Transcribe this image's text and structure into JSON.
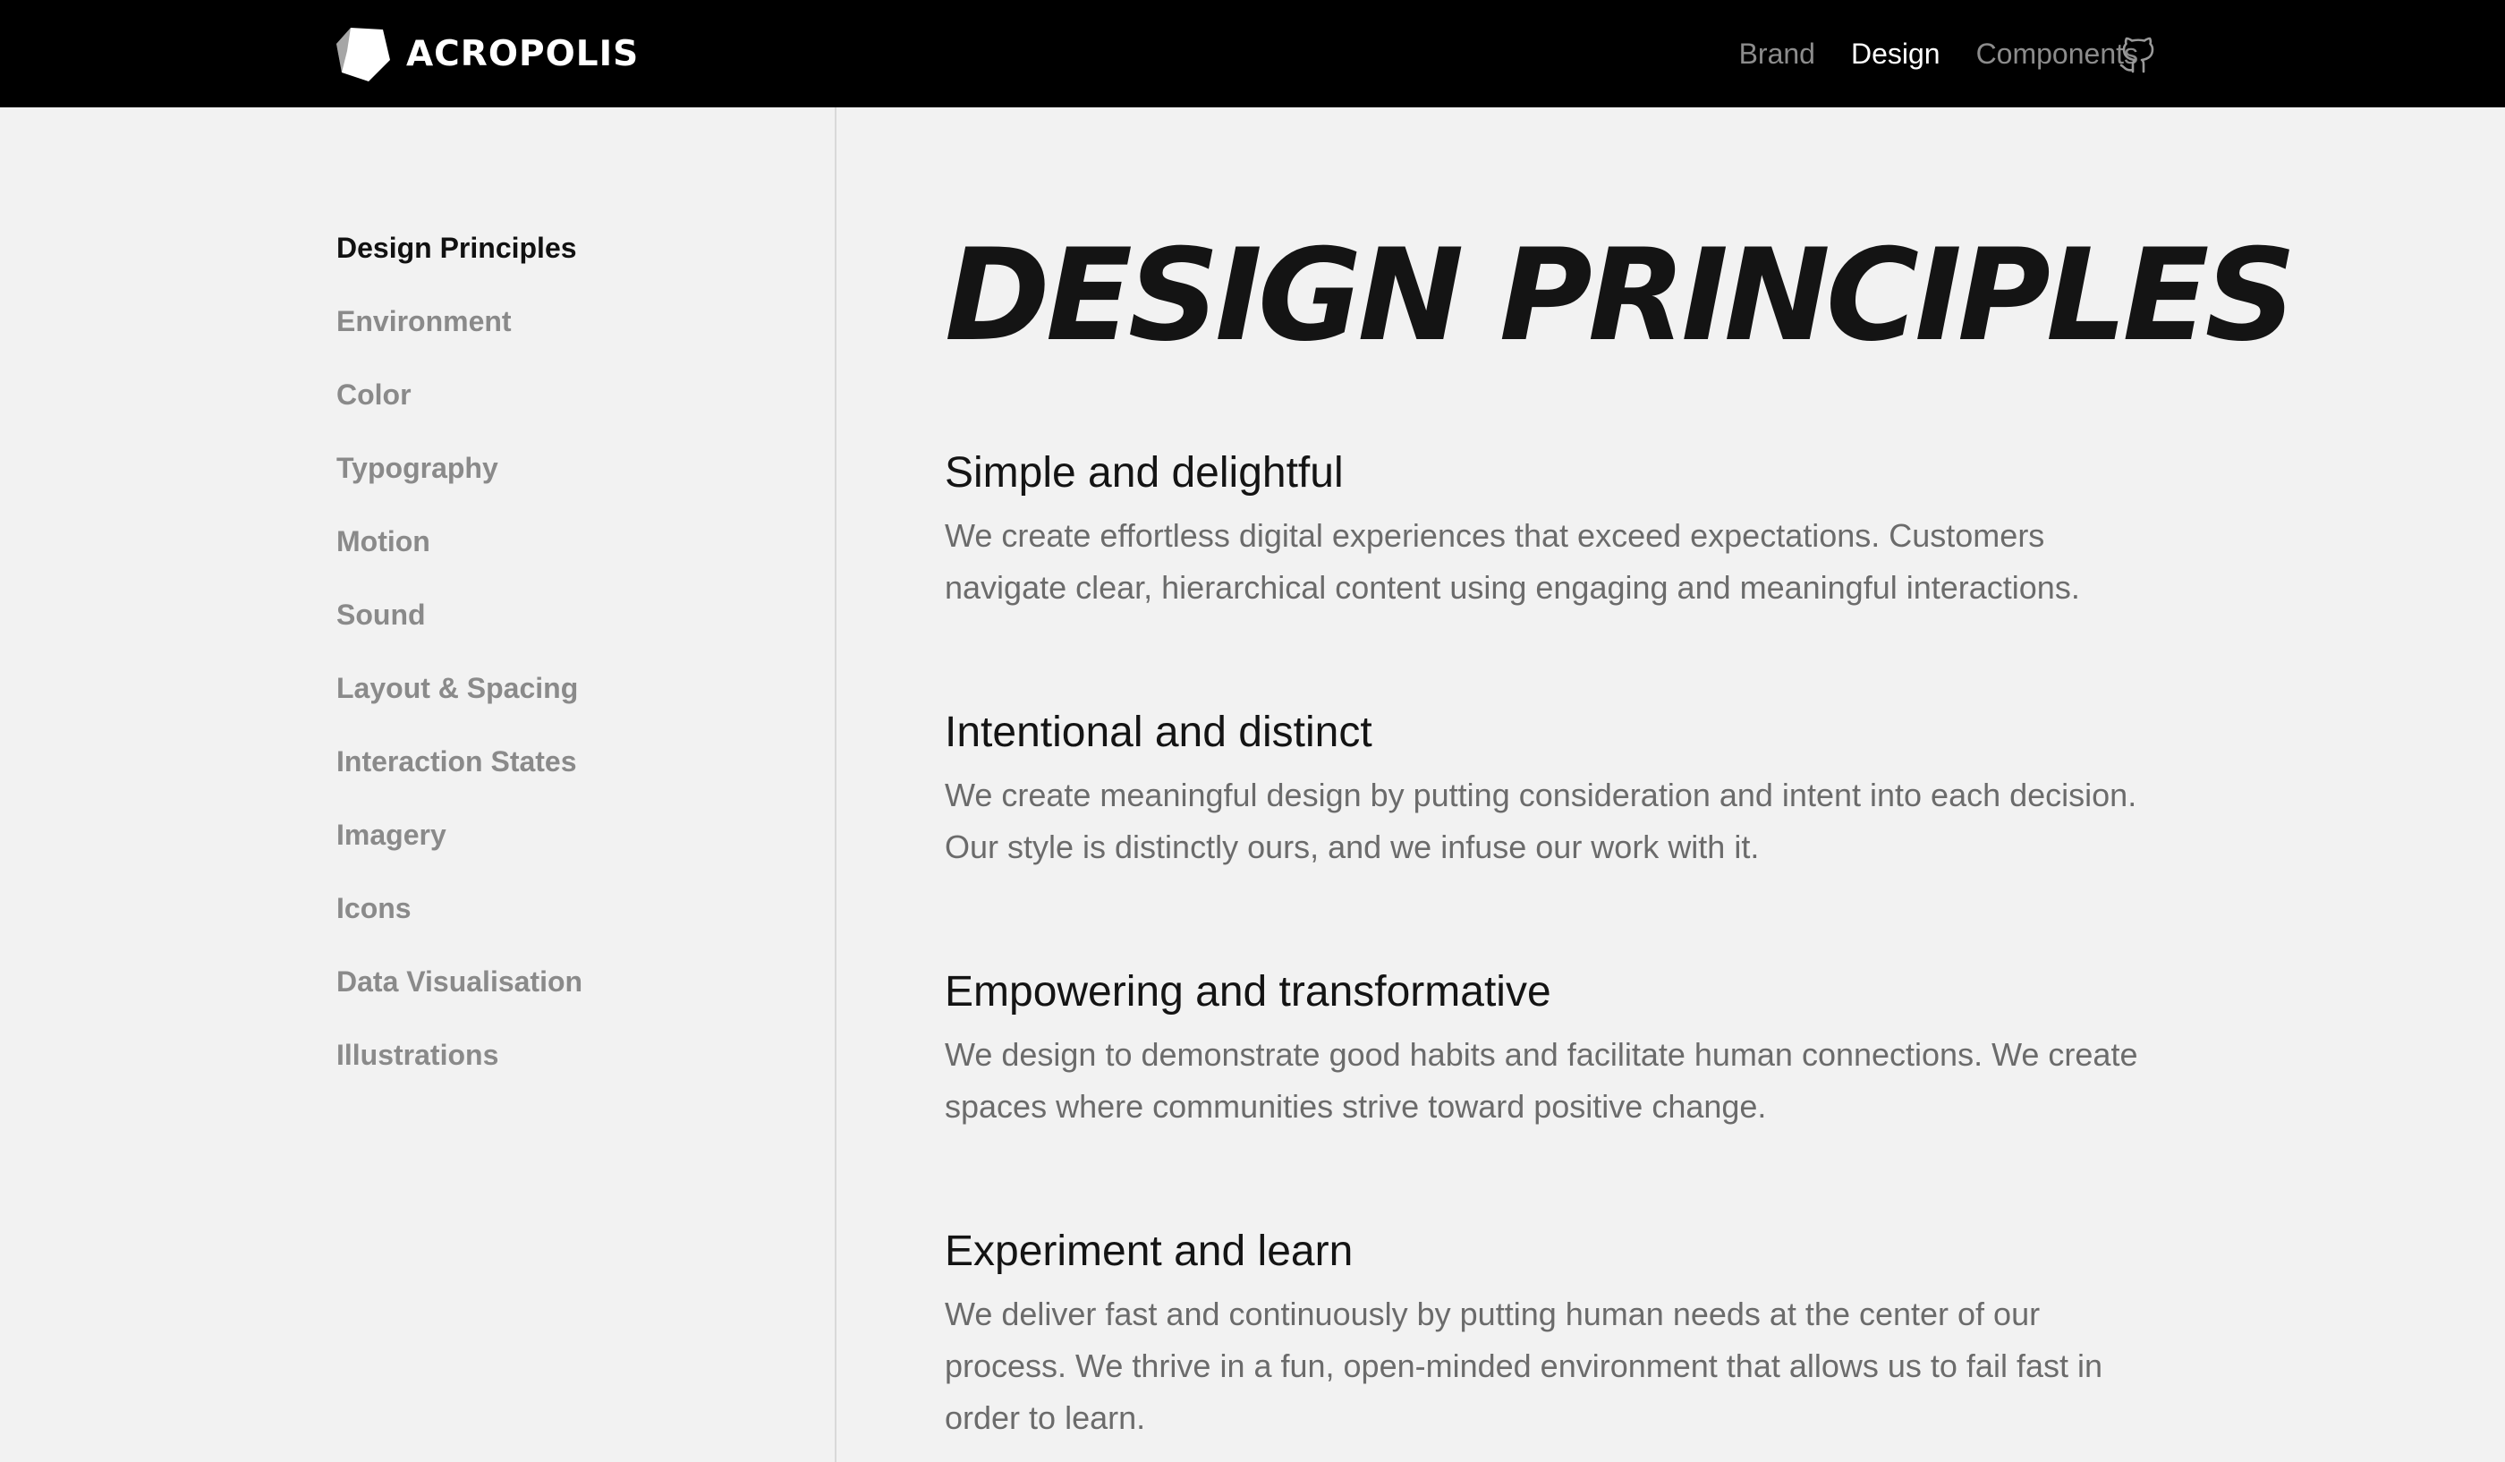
{
  "header": {
    "brand_name": "ACROPOLIS",
    "logo_icon": "hexagon-logo-icon",
    "nav": [
      {
        "label": "Brand",
        "active": false
      },
      {
        "label": "Design",
        "active": true
      },
      {
        "label": "Components",
        "active": false
      }
    ],
    "github_icon": "github-icon",
    "colors": {
      "background": "#000000",
      "active_link": "#ffffff",
      "inactive_link": "#8c8c8c"
    }
  },
  "sidebar": {
    "items": [
      {
        "label": "Design Principles",
        "active": true
      },
      {
        "label": "Environment",
        "active": false
      },
      {
        "label": "Color",
        "active": false
      },
      {
        "label": "Typography",
        "active": false
      },
      {
        "label": "Motion",
        "active": false
      },
      {
        "label": "Sound",
        "active": false
      },
      {
        "label": "Layout & Spacing",
        "active": false
      },
      {
        "label": "Interaction States",
        "active": false
      },
      {
        "label": "Imagery",
        "active": false
      },
      {
        "label": "Icons",
        "active": false
      },
      {
        "label": "Data Visualisation",
        "active": false
      },
      {
        "label": "Illustrations",
        "active": false
      }
    ]
  },
  "main": {
    "title": "DESIGN PRINCIPLES",
    "principles": [
      {
        "heading": "Simple and delightful",
        "body": "We create effortless digital experiences that exceed expectations. Customers navigate clear, hierarchical content using engaging and meaningful interactions."
      },
      {
        "heading": "Intentional and distinct",
        "body": "We create meaningful design by putting consideration and intent into each decision. Our style is distinctly ours, and we infuse our work with it."
      },
      {
        "heading": "Empowering and transformative",
        "body": "We design to demonstrate good habits and facilitate human connections. We create spaces where communities strive toward positive change."
      },
      {
        "heading": "Experiment and learn",
        "body": "We deliver fast and continuously by putting human needs at the center of our process. We thrive in a fun, open-minded environment that allows us to fail fast in order to learn."
      }
    ]
  },
  "colors": {
    "page_background": "#f2f2f2",
    "title_text": "#141414",
    "body_text": "#6b6b6b",
    "divider": "#d9d9d9"
  }
}
